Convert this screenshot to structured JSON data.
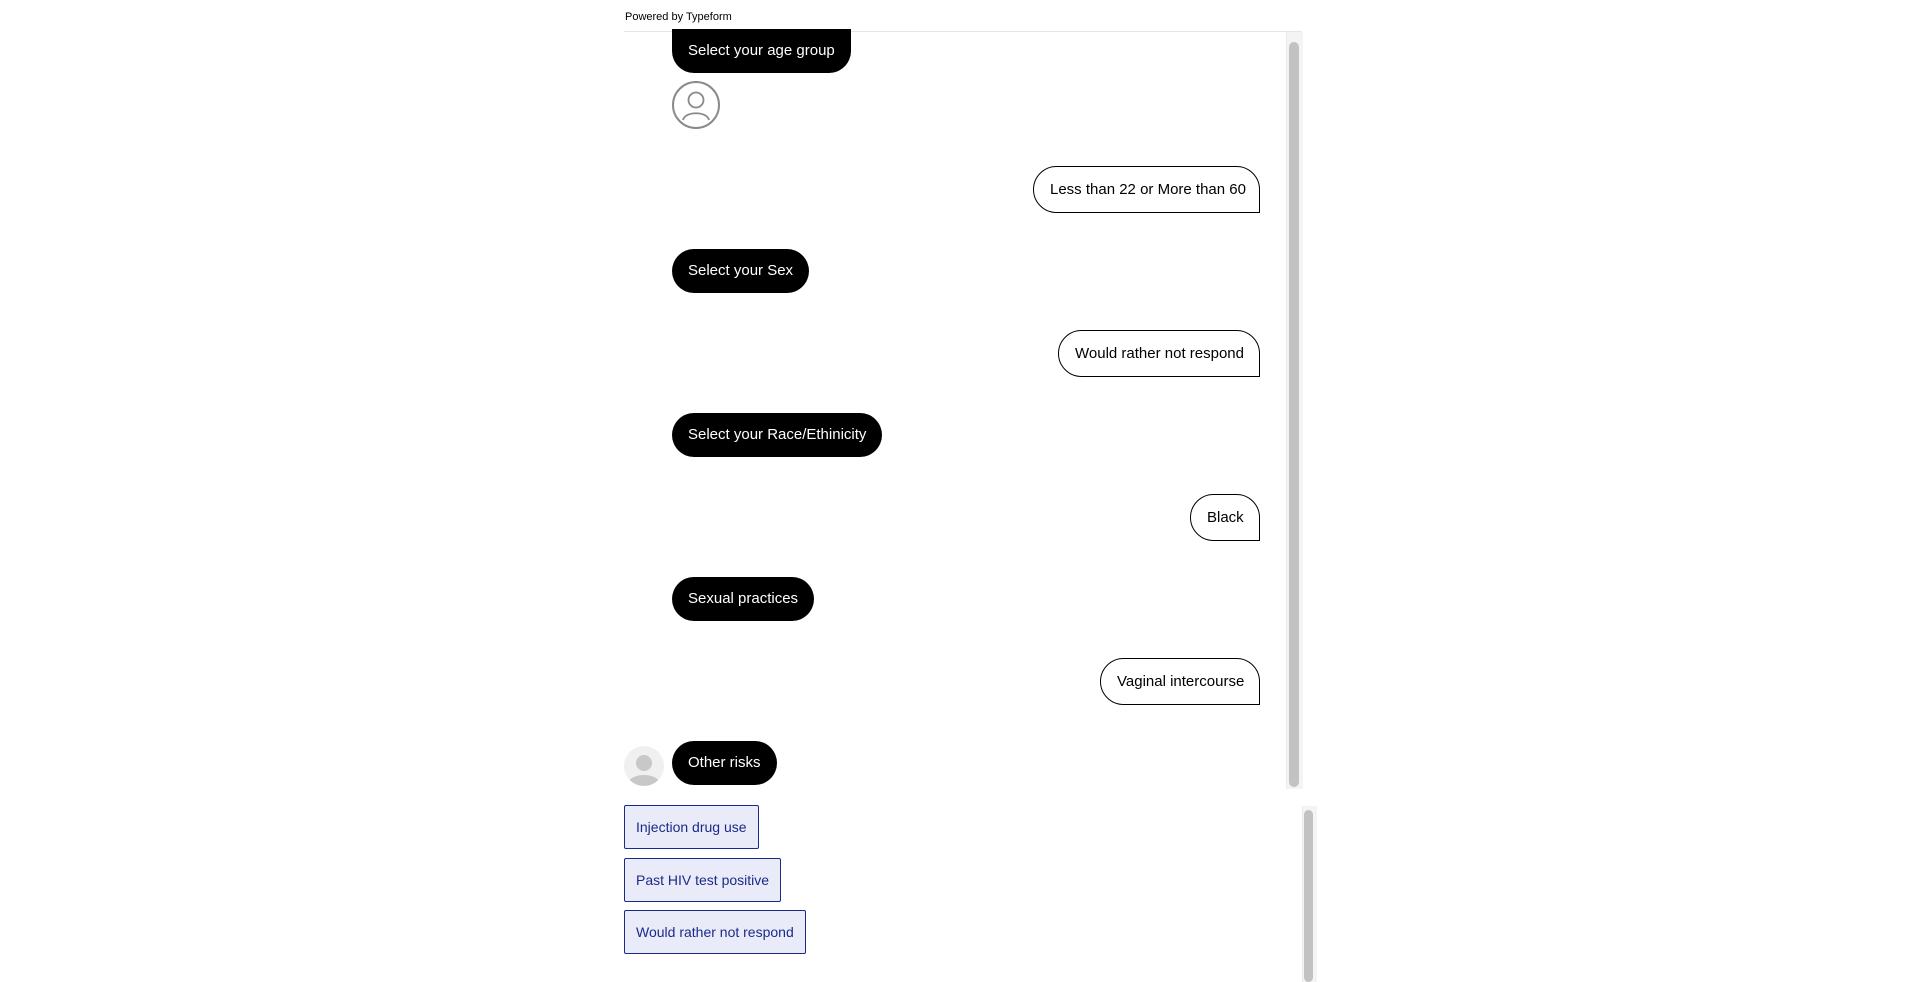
{
  "footer": {
    "powered_by": "Powered by Typeform"
  },
  "conversation": {
    "q_age": "Select your age group",
    "a_age": "Less than 22 or More than 60",
    "q_sex": "Select your Sex",
    "a_sex": "Would rather not respond",
    "q_race": "Select your Race/Ethinicity",
    "a_race": "Black",
    "q_sexual": "Sexual practices",
    "a_sexual": "Vaginal intercourse",
    "q_other": "Other risks"
  },
  "choices": [
    "Injection drug use",
    "Past HIV test positive",
    "Would rather not respond"
  ],
  "icons": {
    "bot_avatar": "user-outline-icon",
    "typing_avatar": "user-silhouette-icon"
  },
  "colors": {
    "bot_bubble": "#000000",
    "choice_text": "#1b2a8a",
    "choice_bg": "#e9ecf8"
  }
}
